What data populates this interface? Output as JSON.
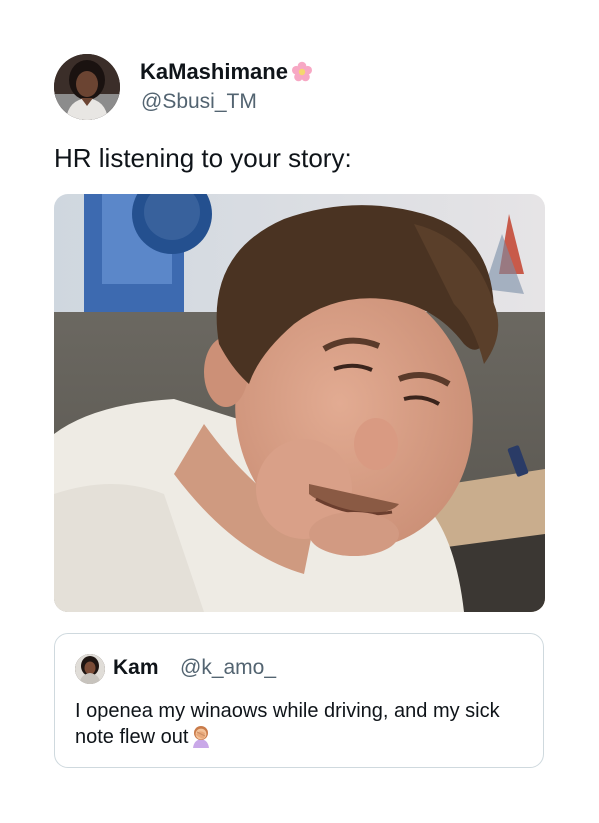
{
  "author": {
    "display_name": "KaMashimane",
    "handle": "@Sbusi_TM",
    "name_emoji": "flower-icon"
  },
  "tweet": {
    "text": "HR listening to your story:"
  },
  "media": {
    "alt_icon": "photo-man-squinting"
  },
  "quoted_tweet": {
    "display_name": "Kam",
    "handle": "@k_amo_",
    "text": "I openea my winaows while driving, and my sick note flew out",
    "emoji": "woman-facepalming-icon"
  },
  "colors": {
    "text": "#0f1419",
    "secondary": "#536471",
    "border": "#cfd9de"
  }
}
